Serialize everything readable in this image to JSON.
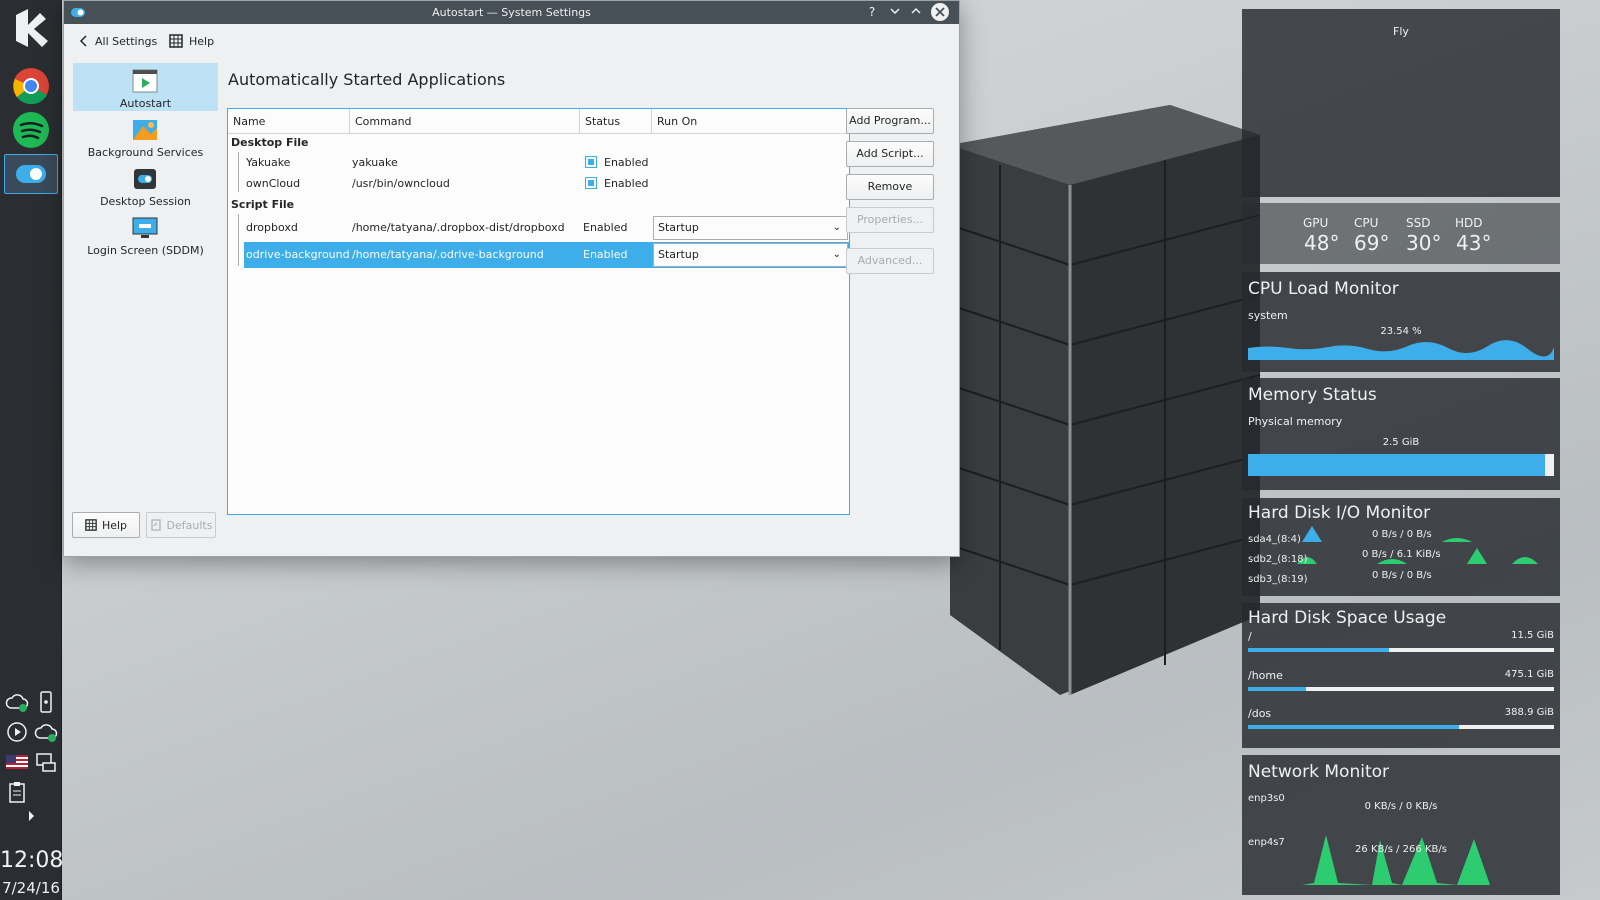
{
  "window": {
    "title": "Autostart — System Settings",
    "toolbar": {
      "all_settings": "All Settings",
      "help": "Help"
    }
  },
  "sidebar": {
    "items": [
      {
        "label": "Autostart",
        "icon": "autostart-icon",
        "selected": true
      },
      {
        "label": "Background Services",
        "icon": "background-services-icon"
      },
      {
        "label": "Desktop Session",
        "icon": "desktop-session-icon"
      },
      {
        "label": "Login Screen (SDDM)",
        "icon": "login-screen-icon"
      }
    ]
  },
  "main": {
    "title": "Automatically Started Applications",
    "columns": [
      "Name",
      "Command",
      "Status",
      "Run On"
    ],
    "groups": {
      "desktop_file": "Desktop File",
      "script_file": "Script File"
    },
    "desktop_rows": [
      {
        "name": "Yakuake",
        "command": "yakuake",
        "status": "Enabled",
        "checked": true
      },
      {
        "name": "ownCloud",
        "command": "/usr/bin/owncloud",
        "status": "Enabled",
        "checked": true
      }
    ],
    "script_rows": [
      {
        "name": "dropboxd",
        "command": "/home/tatyana/.dropbox-dist/dropboxd",
        "status": "Enabled",
        "run_on": "Startup"
      },
      {
        "name": "odrive-background",
        "command": "/home/tatyana/.odrive-background",
        "status": "Enabled",
        "run_on": "Startup",
        "selected": true
      }
    ],
    "buttons": {
      "add_program": "Add Program...",
      "add_script": "Add Script...",
      "remove": "Remove",
      "properties": "Properties...",
      "advanced": "Advanced..."
    },
    "bottom": {
      "help": "Help",
      "defaults": "Defaults"
    }
  },
  "panel": {
    "time": "12:08",
    "date": "7/24/16"
  },
  "widgets": {
    "fly": {
      "label": "Fly"
    },
    "temps": {
      "labels": [
        "GPU",
        "CPU",
        "SSD",
        "HDD"
      ],
      "values": [
        "48°",
        "69°",
        "30°",
        "43°"
      ]
    },
    "cpu": {
      "title": "CPU Load Monitor",
      "sub": "system",
      "value": "23.54 %",
      "fraction": 0.2354
    },
    "memory": {
      "title": "Memory Status",
      "sub": "Physical memory",
      "value": "2.5 GiB",
      "fraction": 0.97
    },
    "disk_io": {
      "title": "Hard Disk I/O Monitor",
      "rows": [
        {
          "name": "sda4_(8:4)",
          "value": "0 B/s / 0 B/s"
        },
        {
          "name": "sdb2_(8:18)",
          "value": "0 B/s / 6.1 KiB/s"
        },
        {
          "name": "sdb3_(8:19)",
          "value": "0 B/s / 0 B/s"
        }
      ]
    },
    "disk_space": {
      "title": "Hard Disk Space Usage",
      "rows": [
        {
          "name": "/",
          "value": "11.5 GiB",
          "fraction": 0.46
        },
        {
          "name": "/home",
          "value": "475.1 GiB",
          "fraction": 0.19
        },
        {
          "name": "/dos",
          "value": "388.9 GiB",
          "fraction": 0.69
        }
      ]
    },
    "network": {
      "title": "Network Monitor",
      "rows": [
        {
          "name": "enp3s0",
          "value": "0 KB/s / 0 KB/s"
        },
        {
          "name": "enp4s7",
          "value": "26 KB/s / 266 KB/s"
        }
      ]
    }
  },
  "colors": {
    "accent": "#3daee9",
    "panel": "#2a2e32",
    "titlebar": "#475057"
  }
}
